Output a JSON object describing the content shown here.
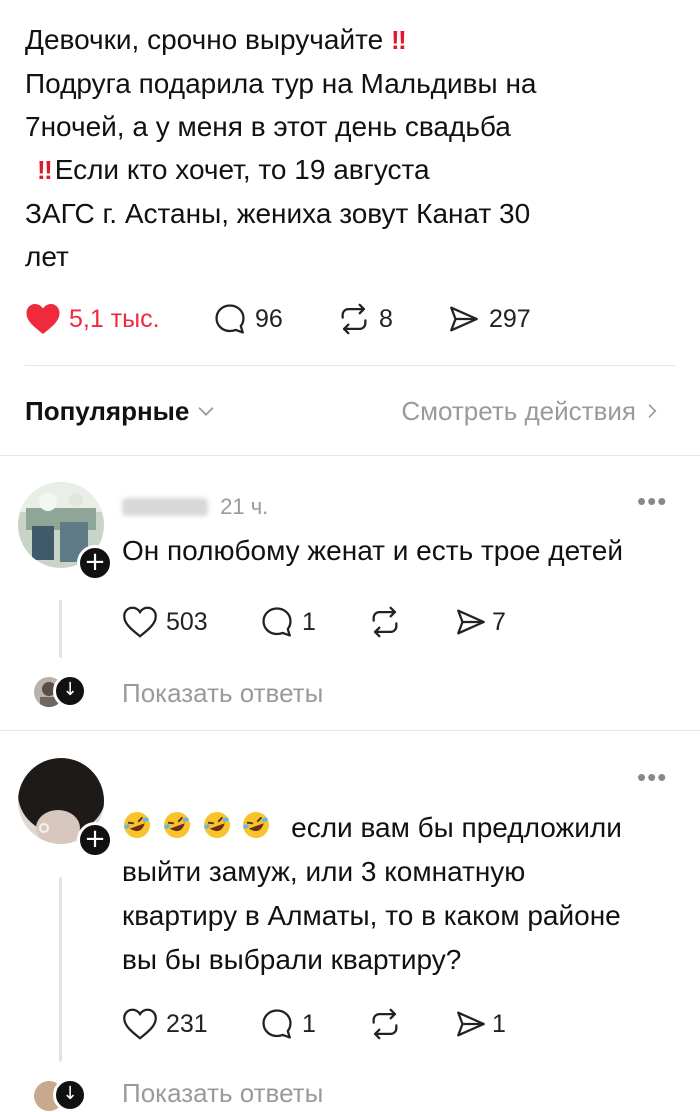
{
  "post": {
    "lines": [
      "Девочки, срочно выручайте",
      "Подруга подарила тур на Мальдивы на",
      "7ночей, а у меня в этот день свадьба",
      "Если кто хочет, то 19 августа",
      "ЗАГС г. Астаны, жениха зовут Канат 30",
      "лет"
    ],
    "bang": "‼",
    "likes": "5,1 тыс.",
    "comments": "96",
    "reposts": "8",
    "shares": "297"
  },
  "sort": {
    "label": "Популярные",
    "view_activity": "Смотреть действия"
  },
  "comments": [
    {
      "meta": "21 ч.",
      "text": "Он полюбому женат и есть трое детей",
      "likes": "503",
      "replies": "1",
      "shares": "7",
      "show_replies": "Показать ответы"
    },
    {
      "text_lines": [
        "если вам бы предложили",
        "выйти замуж, или 3 комнатную",
        "квартиру в Алматы, то в каком районе",
        "вы бы выбрали квартиру?"
      ],
      "likes": "231",
      "replies": "1",
      "shares": "1",
      "show_replies": "Показать ответы"
    }
  ],
  "colors": {
    "like_active": "#ee2a3c",
    "muted": "#9a9a9a",
    "bang": "#e0182d"
  }
}
